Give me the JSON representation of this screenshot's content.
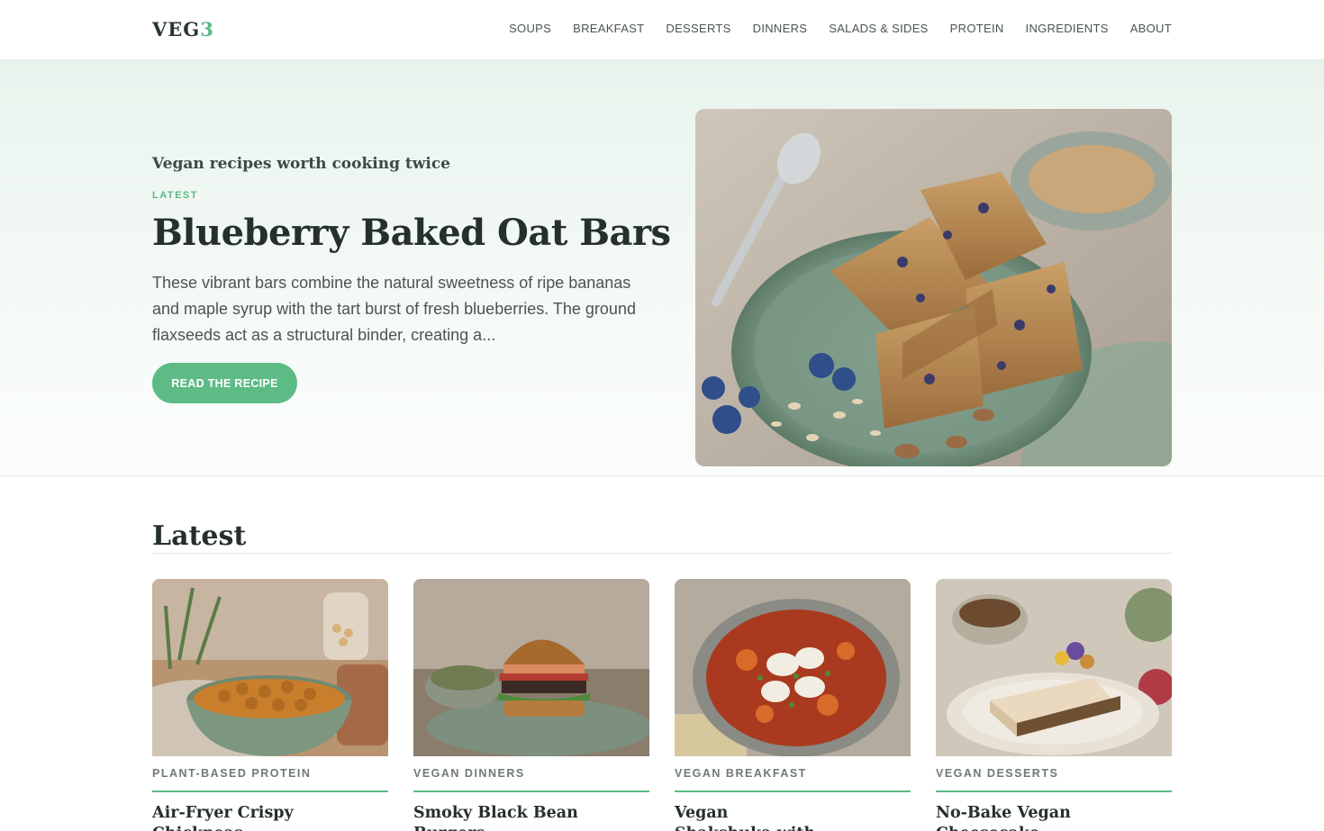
{
  "header": {
    "logo_text": "VEG",
    "logo_accent": "3",
    "nav": [
      "SOUPS",
      "BREAKFAST",
      "DESSERTS",
      "DINNERS",
      "SALADS & SIDES",
      "PROTEIN",
      "INGREDIENTS",
      "ABOUT"
    ]
  },
  "hero": {
    "tagline": "Vegan recipes worth cooking twice",
    "kicker": "LATEST",
    "title": "Blueberry Baked Oat Bars",
    "description": "These vibrant bars combine the natural sweetness of ripe bananas and maple syrup with the tart burst of fresh blueberries. The ground flaxseeds act as a structural binder, creating a...",
    "cta_label": "READ THE RECIPE"
  },
  "latest": {
    "heading": "Latest",
    "cards": [
      {
        "category": "PLANT-BASED PROTEIN",
        "title": "Air-Fryer Crispy Chickpeas"
      },
      {
        "category": "VEGAN DINNERS",
        "title": "Smoky Black Bean Burgers"
      },
      {
        "category": "VEGAN BREAKFAST",
        "title": "Vegan Shakshuka with Silken Tofu"
      },
      {
        "category": "VEGAN DESSERTS",
        "title": "No-Bake Vegan Cheesecake"
      }
    ]
  },
  "colors": {
    "accent": "#5bb884",
    "text": "#25302a",
    "muted": "#4a554f"
  }
}
